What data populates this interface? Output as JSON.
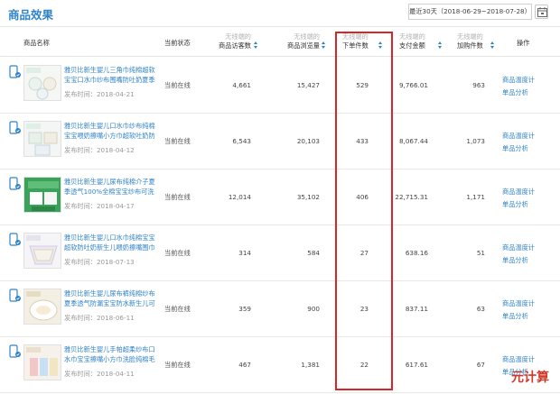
{
  "header": {
    "title": "商品效果",
    "date_range": "最近30天（2018-06-29~2018-07-28）",
    "calendar_icon": "calendar-icon"
  },
  "columns": {
    "product": "商品名称",
    "status": "当前状态",
    "visitors": {
      "sub": "无线端的",
      "main": "商品访客数"
    },
    "pageviews": {
      "sub": "无线端的",
      "main": "商品浏览量"
    },
    "orders": {
      "sub": "无线端的",
      "main": "下单件数"
    },
    "payment": {
      "sub": "无线端的",
      "main": "支付金额"
    },
    "cart": {
      "sub": "无线端的",
      "main": "加购件数"
    },
    "action": "操作"
  },
  "rows": [
    {
      "name": "雅贝比新生婴儿三角巾纯棉超软宝宝口水巾纱布围嘴防吐奶夏季",
      "date": "发布时间：2018-04-21",
      "status": "当前在线",
      "visitors": "4,661",
      "pageviews": "15,427",
      "orders": "529",
      "payment": "9,766.01",
      "cart": "963",
      "op1": "商品温度计",
      "op2": "单品分析"
    },
    {
      "name": "雅贝比新生婴儿口水巾纱布纯棉宝宝喂奶擦嘴小方巾超软吐奶防",
      "date": "发布时间：2018-04-12",
      "status": "当前在线",
      "visitors": "6,543",
      "pageviews": "20,103",
      "orders": "433",
      "payment": "8,067.44",
      "cart": "1,073",
      "op1": "商品温度计",
      "op2": "单品分析"
    },
    {
      "name": "雅贝比新生婴儿尿布纯棉介子夏季透气100%全棉宝宝纱布可洗",
      "date": "发布时间：2018-04-17",
      "status": "当前在线",
      "visitors": "12,014",
      "pageviews": "35,102",
      "orders": "406",
      "payment": "22,715.31",
      "cart": "1,171",
      "op1": "商品温度计",
      "op2": "单品分析"
    },
    {
      "name": "雅贝比新生婴儿口水巾纯棉宝宝超软防吐奶新生儿喂奶擦嘴围巾",
      "date": "发布时间：2018-07-13",
      "status": "当前在线",
      "visitors": "314",
      "pageviews": "584",
      "orders": "27",
      "payment": "638.16",
      "cart": "51",
      "op1": "商品温度计",
      "op2": "单品分析"
    },
    {
      "name": "雅贝比新生婴儿尿布裤纯棉纱布夏季透气防漏宝宝防水新生儿可洗隔",
      "date": "发布时间：2018-06-11",
      "status": "当前在线",
      "visitors": "359",
      "pageviews": "900",
      "orders": "23",
      "payment": "837.11",
      "cart": "63",
      "op1": "商品温度计",
      "op2": "单品分析"
    },
    {
      "name": "雅贝比新生婴儿手帕超柔纱布口水巾宝宝擦嘴小方巾洗脸纯棉毛",
      "date": "发布时间：2018-04-11",
      "status": "当前在线",
      "visitors": "467",
      "pageviews": "1,381",
      "orders": "22",
      "payment": "617.61",
      "cart": "67",
      "op1": "商品温度计",
      "op2": "单品分析"
    }
  ],
  "watermark": "元计算",
  "colors": {
    "accent": "#2f83c9",
    "highlight": "#d7262a",
    "muted": "#b3b3b3",
    "row_border": "#e8e8e8"
  }
}
